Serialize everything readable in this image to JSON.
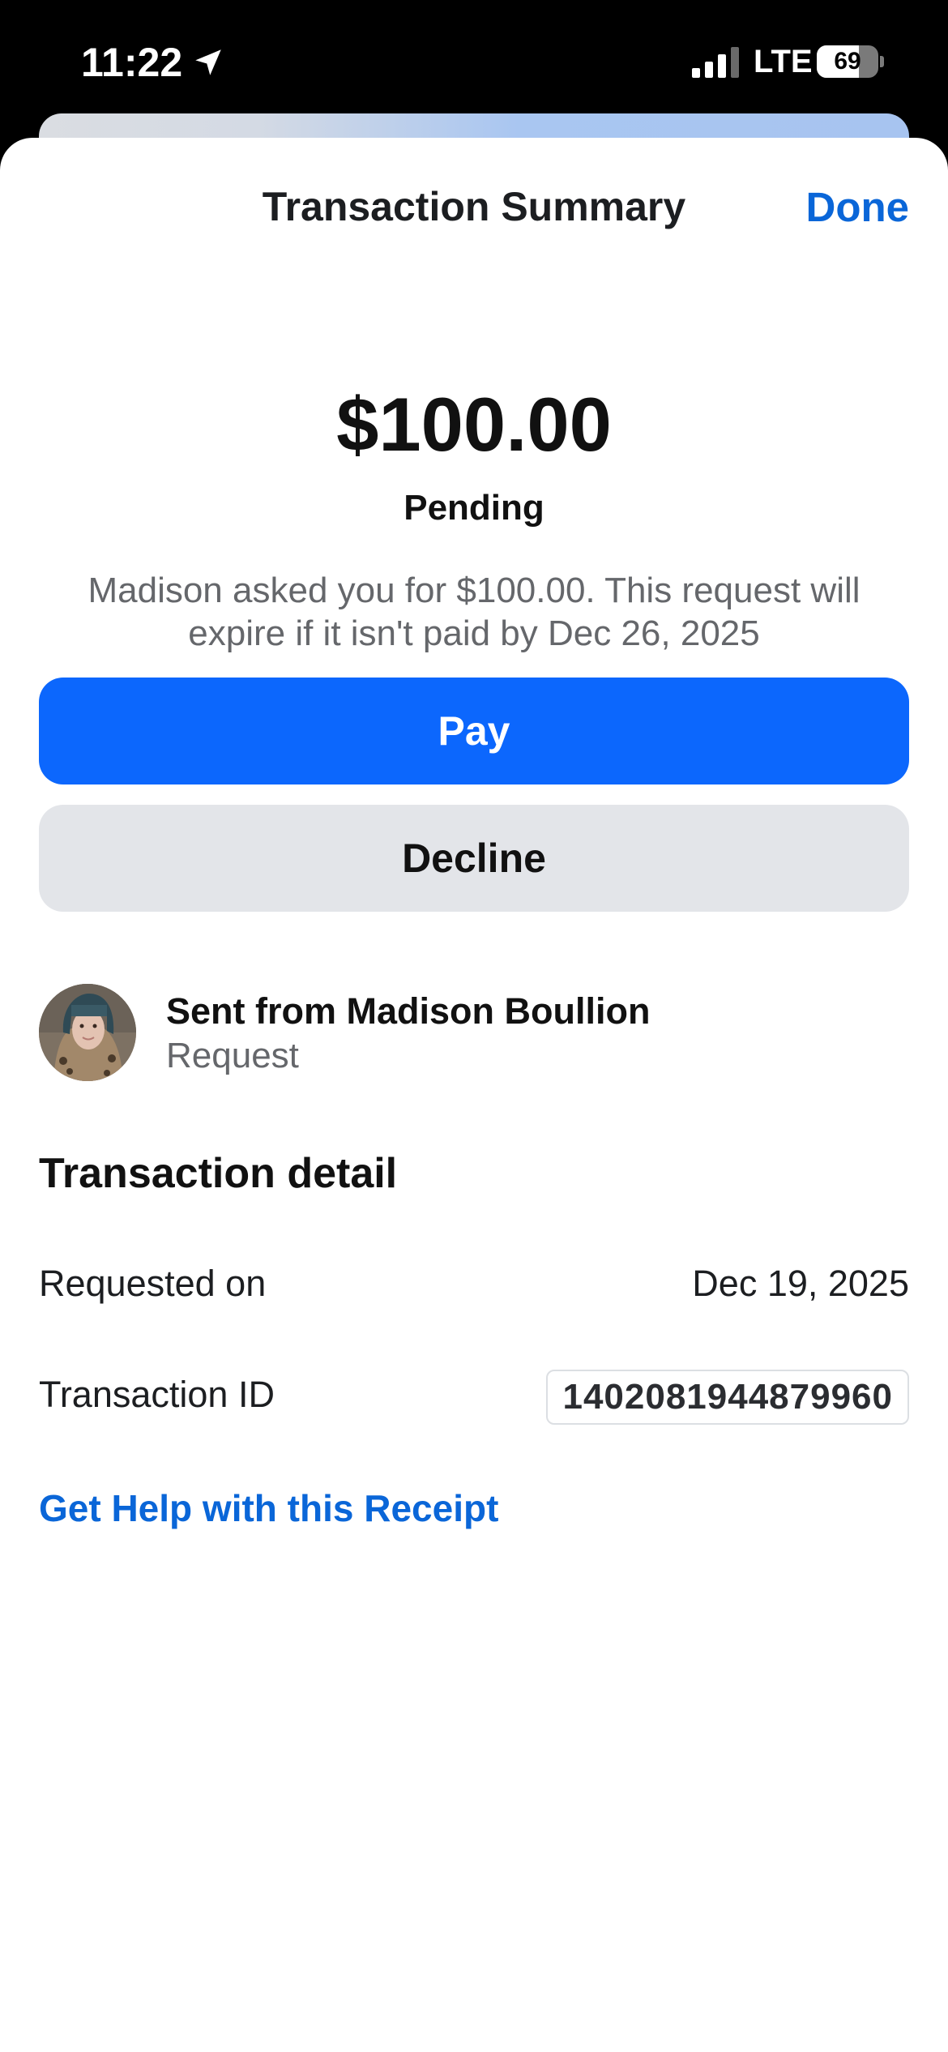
{
  "status_bar": {
    "time": "11:22",
    "network": "LTE",
    "battery_level": "69",
    "battery_fraction": 0.69
  },
  "sheet": {
    "title": "Transaction Summary",
    "done_label": "Done"
  },
  "summary": {
    "amount": "$100.00",
    "status": "Pending",
    "note": "Madison asked you for $100.00. This request will expire if it isn't paid by Dec 26, 2025"
  },
  "actions": {
    "pay_label": "Pay",
    "decline_label": "Decline"
  },
  "sender": {
    "name": "Sent from Madison Boullion",
    "type": "Request"
  },
  "details": {
    "heading": "Transaction detail",
    "requested_on_label": "Requested on",
    "requested_on_value": "Dec 19, 2025",
    "transaction_id_label": "Transaction ID",
    "transaction_id_value": "1402081944879960"
  },
  "help": {
    "link_label": "Get Help with this Receipt"
  },
  "colors": {
    "accent_blue": "#0a66d8",
    "pay_button": "#0c67fd",
    "decline_button": "#e3e5e9",
    "secondary_text": "#65676b"
  },
  "icons": {
    "location": "location-arrow-icon",
    "signal": "cellular-signal-icon",
    "battery": "battery-icon"
  }
}
